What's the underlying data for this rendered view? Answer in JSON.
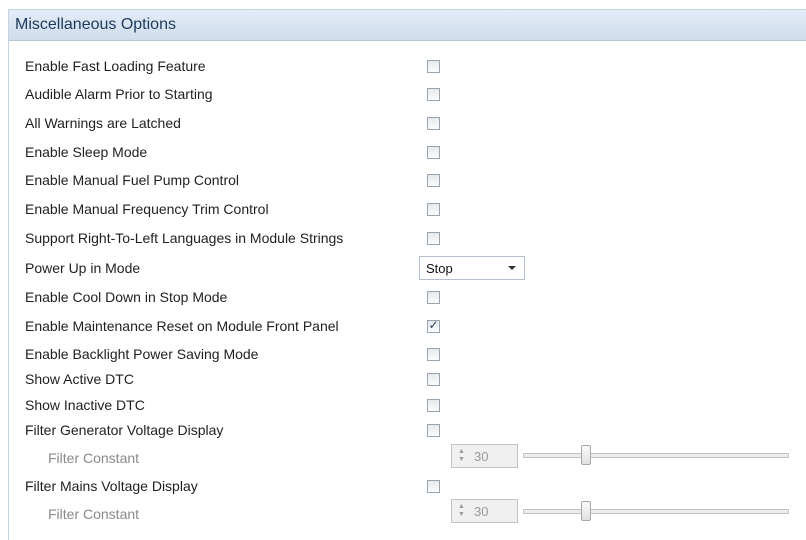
{
  "panel": {
    "title": "Miscellaneous Options"
  },
  "options": [
    {
      "label": "Enable Fast Loading Feature",
      "checked": false
    },
    {
      "label": "Audible Alarm Prior to Starting",
      "checked": false
    },
    {
      "label": "All Warnings are Latched",
      "checked": false
    },
    {
      "label": "Enable Sleep Mode",
      "checked": false
    },
    {
      "label": "Enable Manual Fuel Pump Control",
      "checked": false
    },
    {
      "label": "Enable Manual Frequency Trim Control",
      "checked": false
    },
    {
      "label": "Support Right-To-Left Languages in Module Strings",
      "checked": false
    },
    {
      "label": "Power Up in Mode",
      "value": "Stop"
    },
    {
      "label": "Enable Cool Down in Stop Mode",
      "checked": false
    },
    {
      "label": "Enable Maintenance Reset on Module Front Panel",
      "checked": true
    },
    {
      "label": "Enable Backlight Power Saving Mode",
      "checked": false
    },
    {
      "label": "Show Active DTC",
      "checked": false
    },
    {
      "label": "Show Inactive DTC",
      "checked": false
    },
    {
      "label": "Filter Generator Voltage Display",
      "checked": false
    },
    {
      "label": "Filter Constant",
      "value": "30",
      "slider_fraction": 0.22
    },
    {
      "label": "Filter Mains Voltage Display",
      "checked": false
    },
    {
      "label": "Filter Constant",
      "value": "30",
      "slider_fraction": 0.22
    }
  ],
  "colors": {
    "header_text": "#1e395b",
    "disabled_text": "#8a8a8a"
  }
}
